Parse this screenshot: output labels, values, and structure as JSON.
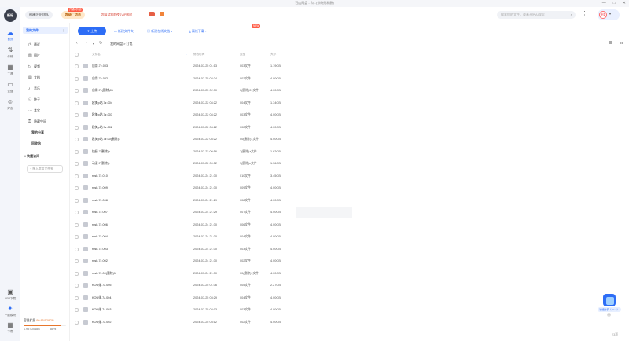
{
  "window": {
    "title": "百度网盘 - 和...(徐晓阳和鹏)",
    "controls": [
      "—",
      "□",
      "✕"
    ]
  },
  "rail": {
    "avatar": "新标",
    "items": [
      {
        "icon": "cloud-icon",
        "glyph": "☁",
        "label": "首页"
      },
      {
        "icon": "transfer-icon",
        "glyph": "⇅",
        "label": "传输"
      },
      {
        "icon": "tools-icon",
        "glyph": "▦",
        "label": "工具"
      },
      {
        "icon": "window-icon",
        "glyph": "▭",
        "label": "云盘"
      },
      {
        "icon": "friends-icon",
        "glyph": "☺",
        "label": "好友"
      }
    ],
    "bottom": [
      {
        "icon": "app-download-icon",
        "glyph": "▣",
        "label": "APP下载"
      },
      {
        "icon": "vip-icon",
        "glyph": "✦",
        "label": "一起模块"
      },
      {
        "icon": "grid-icon",
        "glyph": "▦",
        "label": "下载"
      }
    ]
  },
  "topbar": {
    "team": "创建企业/团队",
    "vip": "超级厂功员",
    "vip_tag": "开通6折起",
    "promo": "超值游戏前夜SVIP限时",
    "search_placeholder": "搜索你的文件，或者开启AI搜索",
    "more": "⋮",
    "user": "登录"
  },
  "nav": {
    "head": "我的文件",
    "head_more": "⋮",
    "items": [
      {
        "icon": "recent-icon",
        "glyph": "◷",
        "label": "最近"
      },
      {
        "icon": "image-icon",
        "glyph": "▨",
        "label": "图片"
      },
      {
        "icon": "video-icon",
        "glyph": "▷",
        "label": "视频"
      },
      {
        "icon": "doc-icon",
        "glyph": "▤",
        "label": "文档"
      },
      {
        "icon": "music-icon",
        "glyph": "♪",
        "label": "音乐"
      },
      {
        "icon": "torrent-icon",
        "glyph": "⚇",
        "label": "种子"
      },
      {
        "icon": "others-icon",
        "glyph": "⋯",
        "label": "其它"
      },
      {
        "icon": "safe-icon",
        "glyph": "⚿",
        "label": "隐藏空间"
      }
    ],
    "share": "我的分享",
    "trash": "回收站",
    "quick": "快捷访问",
    "add_quick": "+ 拖入常用文件夹"
  },
  "storage": {
    "label": "容量扩展",
    "highlight": "99.85/128GB",
    "usage": "1.95T/2048G",
    "percent": "88%",
    "fill_fraction": 0.88
  },
  "toolbar": {
    "upload": "上传",
    "new_folder": "新建文件夹",
    "online_doc": "新建在线文档",
    "offline": "离线下载",
    "new_badge": "NEW"
  },
  "path": {
    "crumb": "我的网盘 > 打包",
    "list_view": "☰",
    "grid_view": "⚏"
  },
  "table": {
    "headers": {
      "name": "文件名",
      "date": "修改时间",
      "type": "类型",
      "size": "大小"
    },
    "rows": [
      {
        "name": "自用.7z.003",
        "date": "2024-07-25 01:13",
        "type": "003文件",
        "size": "1.19GB"
      },
      {
        "name": "自用.7z.002",
        "date": "2024-07-25 02:24",
        "type": "002文件",
        "size": "4.00GB"
      },
      {
        "name": "自用.7z(删除)01",
        "date": "2024-07-25 02:30",
        "type": "0(删除)01文件",
        "size": "4.00GB"
      },
      {
        "name": "欧美p站.7z.004",
        "date": "2024-07-22 04:22",
        "type": "004文件",
        "size": "1.34GB"
      },
      {
        "name": "欧美p站.7z.003",
        "date": "2024-07-22 04:22",
        "type": "003文件",
        "size": "4.00GB"
      },
      {
        "name": "欧美p站.7z.002",
        "date": "2024-07-22 04:22",
        "type": "002文件",
        "size": "4.00GB"
      },
      {
        "name": "欧美p站.7z.00(删除)1",
        "date": "2024-07-22 04:22",
        "type": "00(删除)1文件",
        "size": "4.00GB"
      },
      {
        "name": "快捷.7(删除)z",
        "date": "2024-07-22 00:56",
        "type": "7(删除)z文件",
        "size": "1.62GB"
      },
      {
        "name": "动漫.7(删除)z",
        "date": "2024-07-22 00:52",
        "type": "7(删除)z文件",
        "size": "1.36GB"
      },
      {
        "name": "rush.7z.010",
        "date": "2024-07-24 21:30",
        "type": "010文件",
        "size": "3.45GB"
      },
      {
        "name": "rush.7z.009",
        "date": "2024-07-24 21:30",
        "type": "009文件",
        "size": "4.00GB"
      },
      {
        "name": "rush.7z.008",
        "date": "2024-07-24 21:29",
        "type": "008文件",
        "size": "4.00GB"
      },
      {
        "name": "rush.7z.007",
        "date": "2024-07-24 21:29",
        "type": "007文件",
        "size": "4.00GB"
      },
      {
        "name": "rush.7z.006",
        "date": "2024-07-24 21:30",
        "type": "006文件",
        "size": "4.00GB"
      },
      {
        "name": "rush.7z.004",
        "date": "2024-07-24 21:30",
        "type": "004文件",
        "size": "4.00GB"
      },
      {
        "name": "rush.7z.003",
        "date": "2024-07-24 21:30",
        "type": "003文件",
        "size": "4.00GB"
      },
      {
        "name": "rush.7z.002",
        "date": "2024-07-24 21:30",
        "type": "002文件",
        "size": "4.00GB"
      },
      {
        "name": "rush.7z.00(删除)1",
        "date": "2024-07-24 21:30",
        "type": "00(删除)1文件",
        "size": "4.00GB"
      },
      {
        "name": "KOU佬.7z.005",
        "date": "2024-07-25 01:36",
        "type": "005文件",
        "size": "2.27GB"
      },
      {
        "name": "KOU佬.7z.004",
        "date": "2024-07-25 03:29",
        "type": "004文件",
        "size": "4.00GB"
      },
      {
        "name": "KOU佬.7z.003",
        "date": "2024-07-25 03:03",
        "type": "003文件",
        "size": "4.00GB"
      },
      {
        "name": "KOU佬.7z.002",
        "date": "2024-07-25 03:12",
        "type": "002文件",
        "size": "4.00GB"
      }
    ]
  },
  "assistant": {
    "label": "智能助手（Alt+S）",
    "close": "✕"
  },
  "count": "23项"
}
